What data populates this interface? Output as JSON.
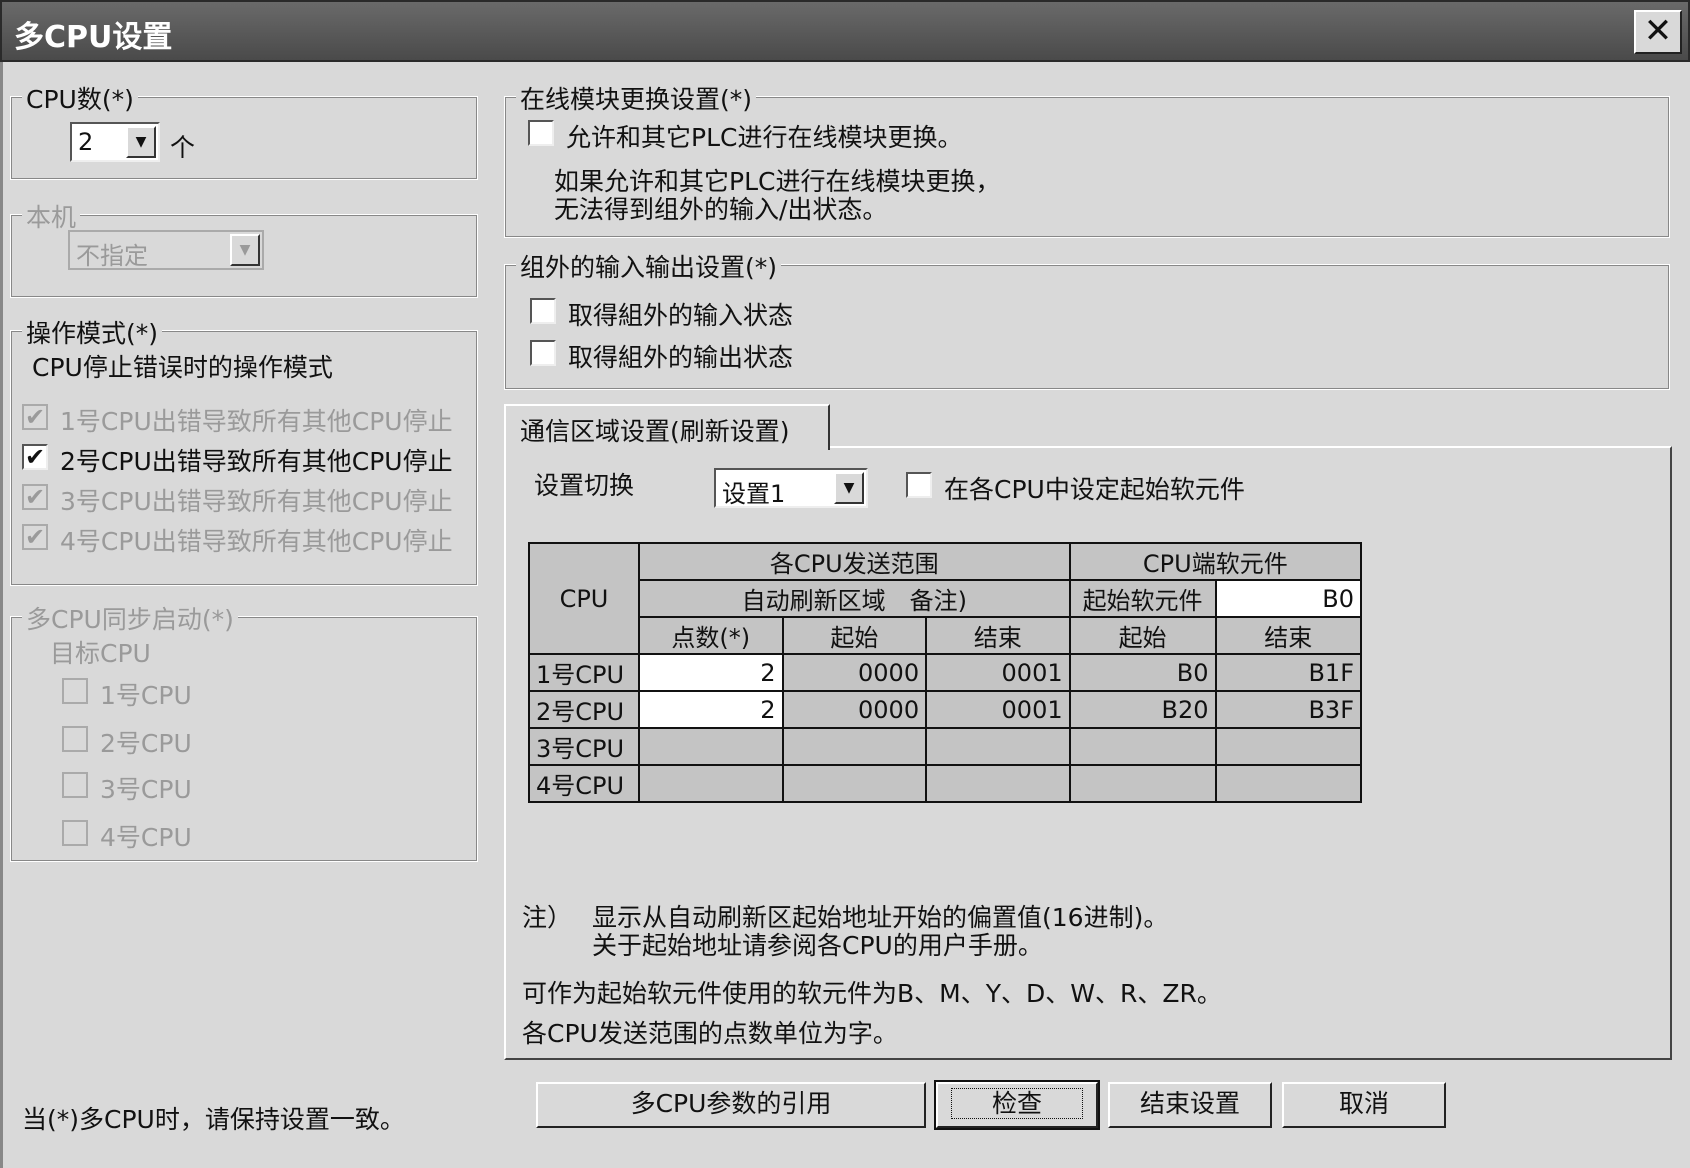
{
  "window": {
    "title": "多CPU设置",
    "close_glyph": "✕"
  },
  "cpu_count": {
    "legend": "CPU数(*)",
    "value": "2",
    "unit": "个",
    "arrow": "▼"
  },
  "local": {
    "legend": "本机",
    "value": "不指定",
    "arrow": "▼"
  },
  "op_mode": {
    "legend": "操作模式(*)",
    "subtitle": "CPU停止错误时的操作模式",
    "items": [
      {
        "label": "1号CPU出错导致所有其他CPU停止",
        "checked": true,
        "enabled": false
      },
      {
        "label": "2号CPU出错导致所有其他CPU停止",
        "checked": true,
        "enabled": true
      },
      {
        "label": "3号CPU出错导致所有其他CPU停止",
        "checked": true,
        "enabled": false
      },
      {
        "label": "4号CPU出错导致所有其他CPU停止",
        "checked": true,
        "enabled": false
      }
    ]
  },
  "sync_start": {
    "legend": "多CPU同步启动(*)",
    "subtitle": "目标CPU",
    "items": [
      {
        "label": "1号CPU",
        "checked": false
      },
      {
        "label": "2号CPU",
        "checked": false
      },
      {
        "label": "3号CPU",
        "checked": false
      },
      {
        "label": "4号CPU",
        "checked": false
      }
    ]
  },
  "footer_note": "当(*)多CPU时，请保持设置一致。",
  "online_replace": {
    "legend": "在线模块更换设置(*)",
    "checkbox_label": "允许和其它PLC进行在线模块更换。",
    "note_line1": "如果允许和其它PLC进行在线模块更换，",
    "note_line2": "无法得到组外的输入/出状态。"
  },
  "io_outside": {
    "legend": "组外的输入输出设置(*)",
    "input_label": "取得組外的输入状态",
    "output_label": "取得組外的输出状态"
  },
  "comm": {
    "tab_label": "通信区域设置(刷新设置)",
    "switch_label": "设置切换",
    "switch_value": "设置1",
    "arrow": "▼",
    "start_device_label": "在各CPU中设定起始软元件",
    "table": {
      "h_cpu": "CPU",
      "h_send_range": "各CPU发送范围",
      "h_cpu_device": "CPU端软元件",
      "h_auto_area": "自动刷新区域　备注)",
      "h_start_device": "起始软元件",
      "start_device_value": "B0",
      "h_points": "点数(*)",
      "h_start": "起始",
      "h_end": "结束",
      "h_dev_start": "起始",
      "h_dev_end": "结束",
      "rows": [
        {
          "cpu": "1号CPU",
          "points": "2",
          "start": "0000",
          "end": "0001",
          "dev_start": "B0",
          "dev_end": "B1F"
        },
        {
          "cpu": "2号CPU",
          "points": "2",
          "start": "0000",
          "end": "0001",
          "dev_start": "B20",
          "dev_end": "B3F"
        },
        {
          "cpu": "3号CPU",
          "points": "",
          "start": "",
          "end": "",
          "dev_start": "",
          "dev_end": ""
        },
        {
          "cpu": "4号CPU",
          "points": "",
          "start": "",
          "end": "",
          "dev_start": "",
          "dev_end": ""
        }
      ]
    },
    "note_label": "注）",
    "note_line1": "显示从自动刷新区起始地址开始的偏置值(16进制)。",
    "note_line2": "关于起始地址请参阅各CPU的用户手册。",
    "note_line3": "可作为起始软元件使用的软元件为B、M、Y、D、W、R、ZR。",
    "note_line4": "各CPU发送范围的点数单位为字。"
  },
  "buttons": {
    "import": "多CPU参数的引用",
    "check": "检查",
    "finish": "结束设置",
    "cancel": "取消"
  }
}
